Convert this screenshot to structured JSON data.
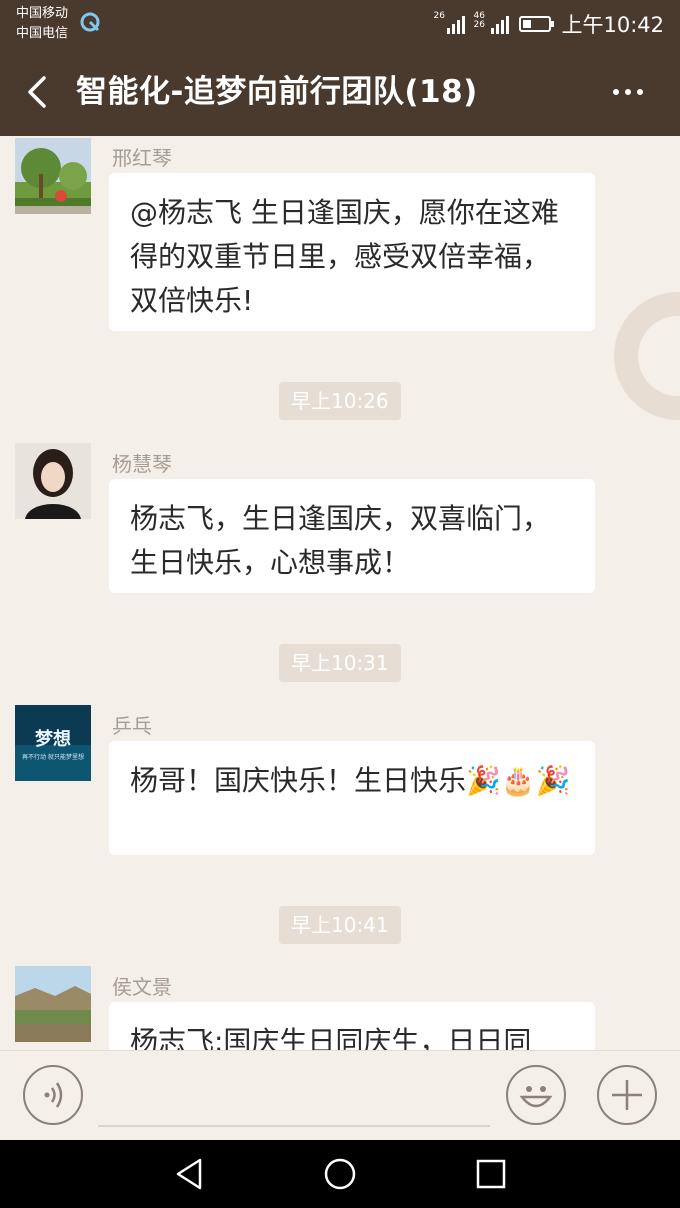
{
  "status": {
    "carrier1": "中国移动",
    "carrier2": "中国电信",
    "net1": "26",
    "net2": "46 26",
    "time": "上午10:42"
  },
  "header": {
    "title": "智能化-追梦向前行团队(18)"
  },
  "messages": [
    {
      "sender": "邢红琴",
      "text": "@杨志飞  生日逢国庆，愿你在这难得的双重节日里，感受双倍幸福，双倍快乐!"
    },
    {
      "time": "早上10:26"
    },
    {
      "sender": "杨慧琴",
      "text": "杨志飞，生日逢国庆，双喜临门，生日快乐，心想事成！"
    },
    {
      "time": "早上10:31"
    },
    {
      "sender": "乒乓",
      "text": "杨哥！国庆快乐！生日快乐🎉🎂🎉"
    },
    {
      "time": "早上10:41"
    },
    {
      "sender": "侯文景",
      "text": "杨志飞:国庆生日同庆生，日日同"
    }
  ],
  "avatar_text": {
    "m3_big": "梦想",
    "m3_small": "再不行动 就只能梦里想"
  },
  "icons": {
    "back": "back-arrow-icon",
    "more": "more-dots-icon",
    "voice": "voice-icon",
    "emoji": "emoji-icon",
    "plus": "plus-icon"
  },
  "colors": {
    "header_bg": "#4a3a2e",
    "chat_bg": "#f4efe9",
    "time_badge": "#e6ddd4"
  }
}
